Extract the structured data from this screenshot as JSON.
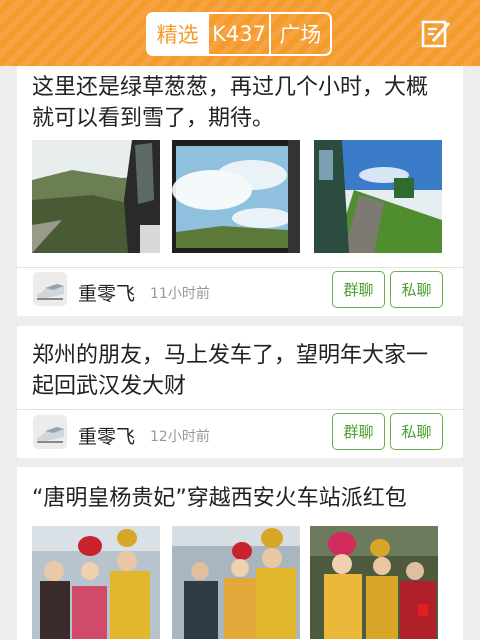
{
  "header": {
    "tabs": [
      {
        "label": "精选",
        "active": true
      },
      {
        "label": "K437",
        "active": false
      },
      {
        "label": "广场",
        "active": false
      }
    ],
    "compose_icon": "compose-icon",
    "accent_color": "#f59a2c"
  },
  "posts": [
    {
      "text": "这里还是绿草葱葱，再过几个小时，大概就可以看到雪了，期待。",
      "author": "重零飞",
      "time": "11小时前",
      "group_chat_label": "群聊",
      "private_chat_label": "私聊"
    },
    {
      "text": "郑州的朋友，马上发车了，望明年大家一起回武汉发大财",
      "author": "重零飞",
      "time": "12小时前",
      "group_chat_label": "群聊",
      "private_chat_label": "私聊"
    },
    {
      "text": "“唐明皇杨贵妃”穿越西安火车站派红包"
    }
  ],
  "colors": {
    "button_green": "#4aa02f",
    "background": "#ededed"
  }
}
